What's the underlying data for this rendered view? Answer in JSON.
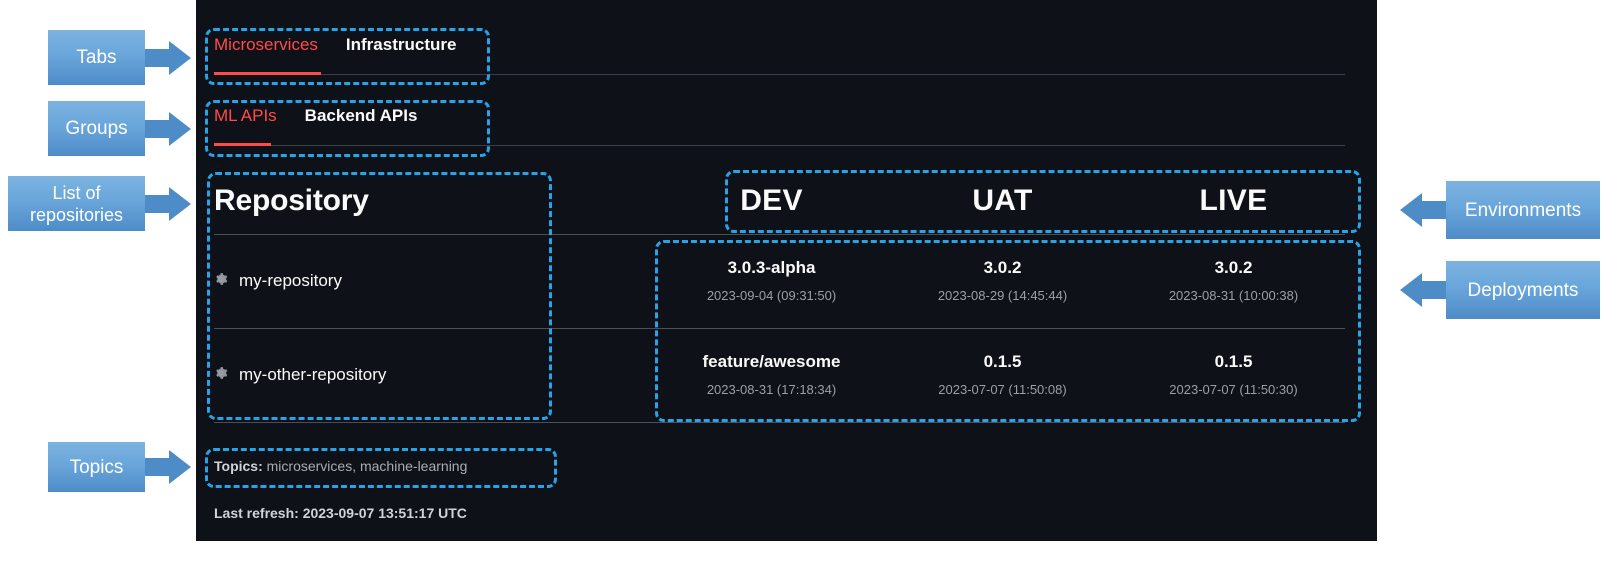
{
  "app": {
    "tabs": {
      "items": [
        {
          "label": "Microservices",
          "active": true
        },
        {
          "label": "Infrastructure",
          "active": false
        }
      ]
    },
    "groups": {
      "items": [
        {
          "label": "ML APIs",
          "active": true
        },
        {
          "label": "Backend APIs",
          "active": false
        }
      ]
    },
    "table": {
      "headers": {
        "repository": "Repository",
        "environments": [
          "DEV",
          "UAT",
          "LIVE"
        ]
      },
      "rows": [
        {
          "icon": "gear-icon",
          "name": "my-repository",
          "deployments": [
            {
              "version": "3.0.3-alpha",
              "timestamp": "2023-09-04 (09:31:50)"
            },
            {
              "version": "3.0.2",
              "timestamp": "2023-08-29 (14:45:44)"
            },
            {
              "version": "3.0.2",
              "timestamp": "2023-08-31 (10:00:38)"
            }
          ]
        },
        {
          "icon": "gear-icon",
          "name": "my-other-repository",
          "deployments": [
            {
              "version": "feature/awesome",
              "timestamp": "2023-08-31 (17:18:34)"
            },
            {
              "version": "0.1.5",
              "timestamp": "2023-07-07 (11:50:08)"
            },
            {
              "version": "0.1.5",
              "timestamp": "2023-07-07 (11:50:30)"
            }
          ]
        }
      ]
    },
    "footer": {
      "topics_label": "Topics:",
      "topics_value": " microservices, machine-learning",
      "last_refresh": "Last refresh: 2023-09-07 13:51:17 UTC"
    }
  },
  "annotations": {
    "tabs": "Tabs",
    "groups": "Groups",
    "list_of_repositories": "List of\nrepositories",
    "topics": "Topics",
    "environments": "Environments",
    "deployments": "Deployments"
  },
  "colors": {
    "accent_red": "#ff4b4b",
    "panel_bg": "#0e1117",
    "annotation_blue": "#29a3e8",
    "callout_blue": "#4e8cc8"
  }
}
